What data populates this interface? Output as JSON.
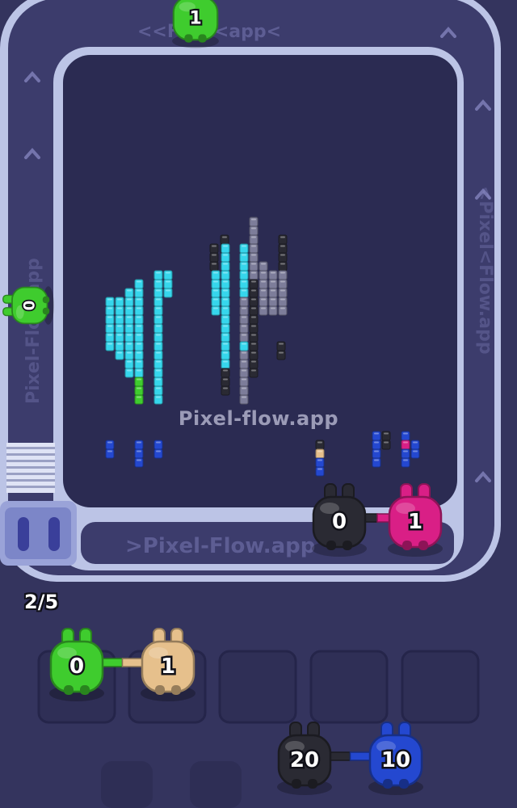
{
  "watermark": "Pixel-flow.app",
  "belt_text": {
    "top": "<<Flow<app<",
    "bottom": ">Pixel-Flow.app",
    "left": "Pixel-Flow.app",
    "right": "<Pixel<Flow.app"
  },
  "progress": "2/5",
  "conveyor_units": [
    {
      "color": "green",
      "count": "1"
    },
    {
      "color": "green",
      "count": "0"
    }
  ],
  "front_queue": [
    {
      "color": "black",
      "count": "0"
    },
    {
      "color": "magenta",
      "count": "1"
    }
  ],
  "slots": {
    "total": 5,
    "filled": [
      {
        "color": "green",
        "count": "0"
      },
      {
        "color": "tan",
        "count": "1"
      }
    ]
  },
  "bottom_queue": [
    {
      "color": "black",
      "count": "20"
    },
    {
      "color": "blue",
      "count": "10"
    }
  ],
  "colors": {
    "background": "#34345e",
    "belt": "#bcc4e6",
    "board": "#2b2b52",
    "cyan": "#36d6ec",
    "green": "#3fcc2e",
    "magenta": "#d91f86",
    "tan": "#e6c08c",
    "black": "#2a2a33",
    "blue": "#2448d0",
    "gray": "#7d7d9a"
  }
}
